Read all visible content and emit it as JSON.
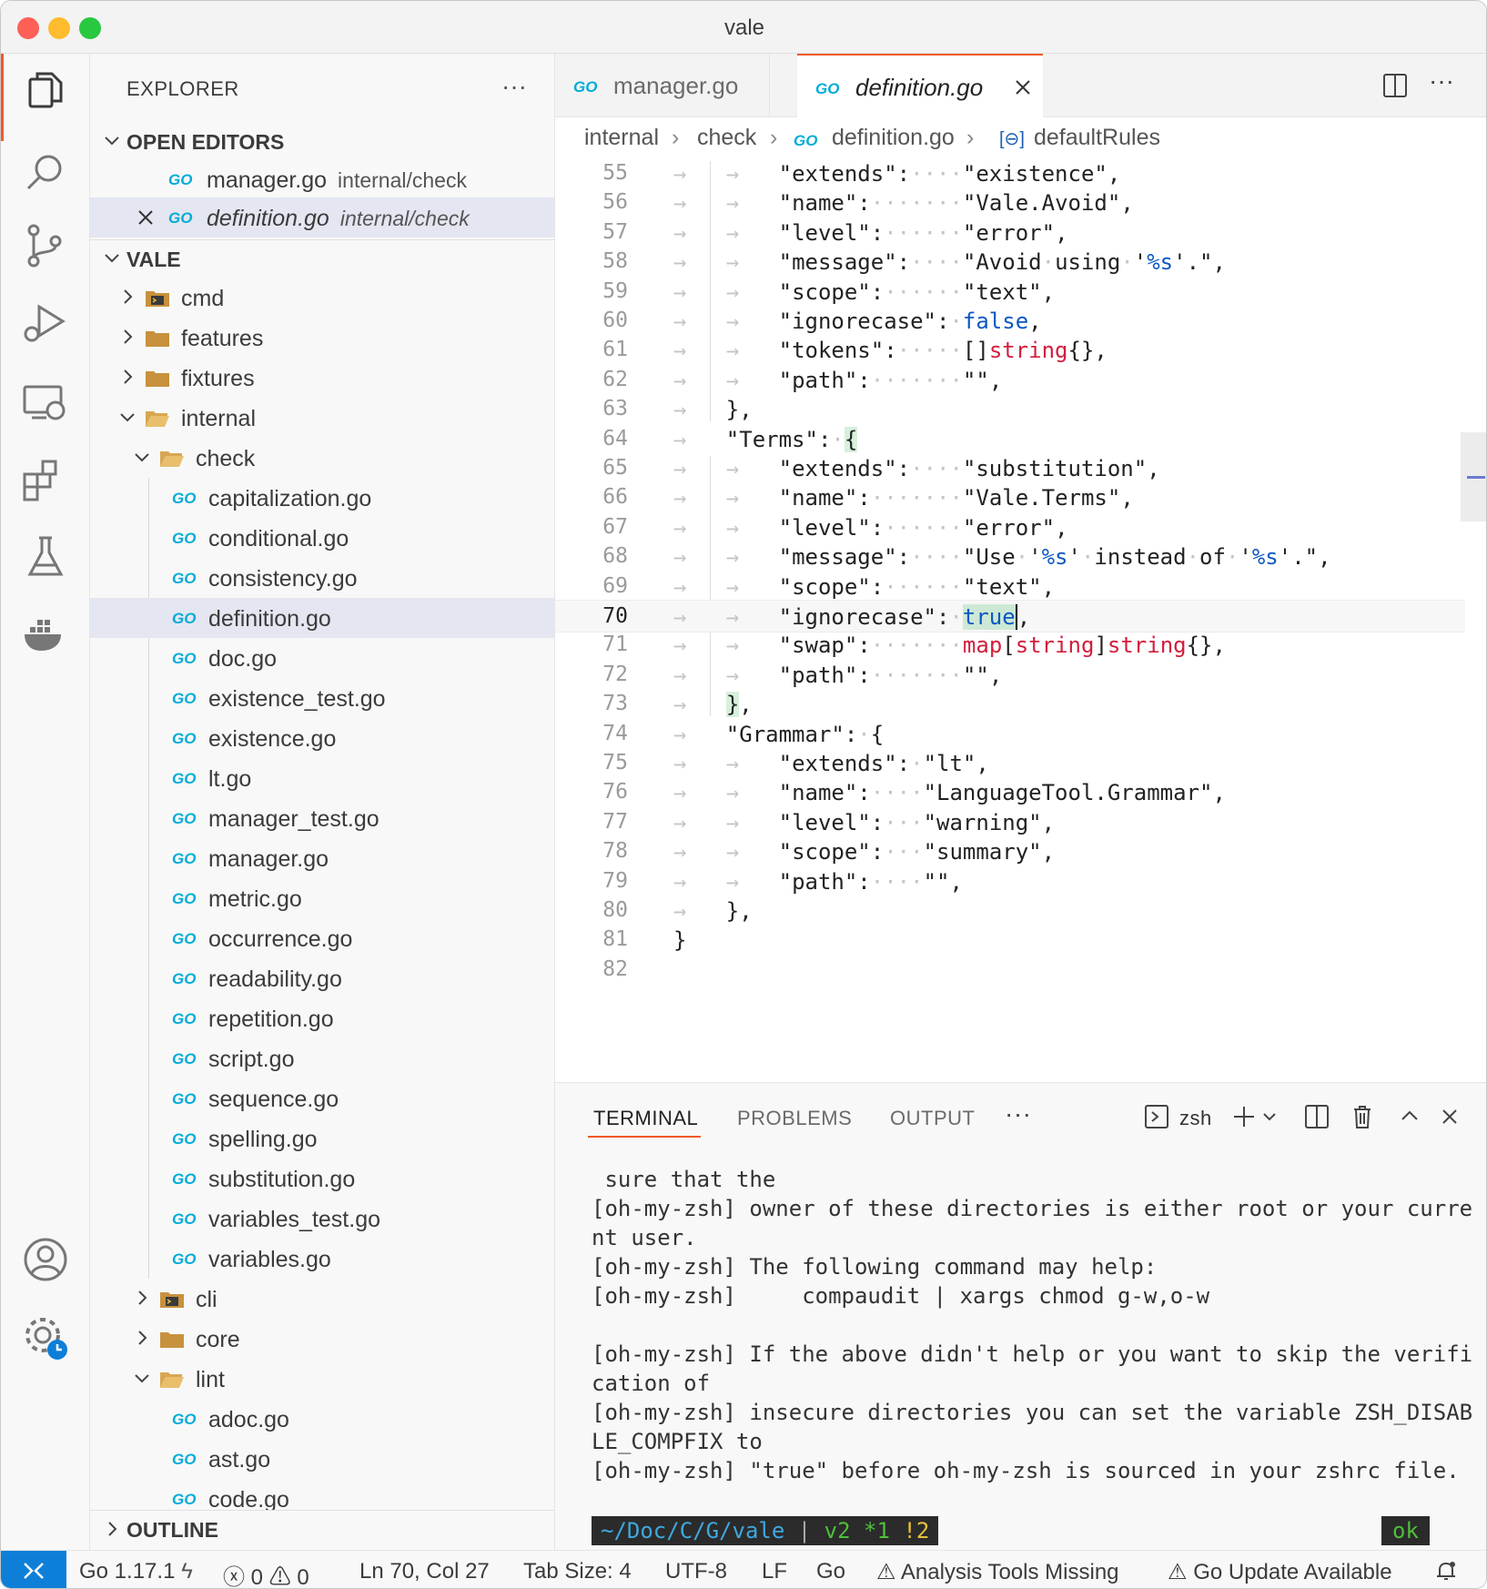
{
  "window": {
    "title": "vale"
  },
  "colors": {
    "accent": "#f05a24",
    "go_blue": "#00acd7",
    "folder": "#c8913d",
    "status_remote": "#0e7fd8"
  },
  "activity_bar": [
    "explorer-icon",
    "search-icon",
    "source-control-icon",
    "run-debug-icon",
    "remote-explorer-icon",
    "extensions-icon",
    "testing-icon",
    "docker-icon",
    "account-icon",
    "settings-gear-icon"
  ],
  "sidebar": {
    "title": "EXPLORER",
    "more": "···",
    "open_editors": {
      "label": "OPEN EDITORS",
      "items": [
        {
          "name": "manager.go",
          "path": "internal/check"
        },
        {
          "name": "definition.go",
          "path": "internal/check"
        }
      ]
    },
    "project": {
      "label": "VALE",
      "items": [
        {
          "label": "cmd"
        },
        {
          "label": "features"
        },
        {
          "label": "fixtures"
        },
        {
          "label": "internal"
        },
        {
          "label": "check"
        },
        {
          "label": "capitalization.go"
        },
        {
          "label": "conditional.go"
        },
        {
          "label": "consistency.go"
        },
        {
          "label": "definition.go"
        },
        {
          "label": "doc.go"
        },
        {
          "label": "existence_test.go"
        },
        {
          "label": "existence.go"
        },
        {
          "label": "lt.go"
        },
        {
          "label": "manager_test.go"
        },
        {
          "label": "manager.go"
        },
        {
          "label": "metric.go"
        },
        {
          "label": "occurrence.go"
        },
        {
          "label": "readability.go"
        },
        {
          "label": "repetition.go"
        },
        {
          "label": "script.go"
        },
        {
          "label": "sequence.go"
        },
        {
          "label": "spelling.go"
        },
        {
          "label": "substitution.go"
        },
        {
          "label": "variables_test.go"
        },
        {
          "label": "variables.go"
        },
        {
          "label": "cli"
        },
        {
          "label": "core"
        },
        {
          "label": "lint"
        },
        {
          "label": "adoc.go"
        },
        {
          "label": "ast.go"
        },
        {
          "label": "code.go"
        }
      ]
    },
    "outline": {
      "label": "OUTLINE"
    }
  },
  "editor": {
    "tabs": [
      {
        "label": "manager.go"
      },
      {
        "label": "definition.go"
      }
    ],
    "more": "···",
    "breadcrumb": [
      "internal",
      "check",
      "definition.go",
      "defaultRules"
    ],
    "line_numbers": [
      "55",
      "56",
      "57",
      "58",
      "59",
      "60",
      "61",
      "62",
      "63",
      "64",
      "65",
      "66",
      "67",
      "68",
      "69",
      "70",
      "71",
      "72",
      "73",
      "74",
      "75",
      "76",
      "77",
      "78",
      "79",
      "80",
      "81",
      "82"
    ]
  },
  "panel": {
    "tabs": [
      "TERMINAL",
      "PROBLEMS",
      "OUTPUT"
    ],
    "more": "···",
    "shell": "zsh",
    "terminal_lines": [
      " sure that the",
      "[oh-my-zsh] owner of these directories is either root or your curre",
      "nt user.",
      "[oh-my-zsh] The following command may help:",
      "[oh-my-zsh]     compaudit | xargs chmod g-w,o-w",
      "",
      "[oh-my-zsh] If the above didn't help or you want to skip the verifi",
      "cation of",
      "[oh-my-zsh] insecure directories you can set the variable ZSH_DISAB",
      "LE_COMPFIX to",
      "[oh-my-zsh] \"true\" before oh-my-zsh is sourced in your zshrc file."
    ],
    "prompt": {
      "path": "~/Doc/C/G/vale",
      "sep": "|",
      "branch": "v2",
      "staged": "*1",
      "changed": "!2"
    },
    "status_ok": "ok"
  },
  "status_bar": {
    "go_version": "Go 1.17.1",
    "errors": "0",
    "warnings": "0",
    "position": "Ln 70, Col 27",
    "tab_size": "Tab Size: 4",
    "encoding": "UTF-8",
    "eol": "LF",
    "language": "Go",
    "analysis": "Analysis Tools Missing",
    "update": "Go Update Available"
  }
}
